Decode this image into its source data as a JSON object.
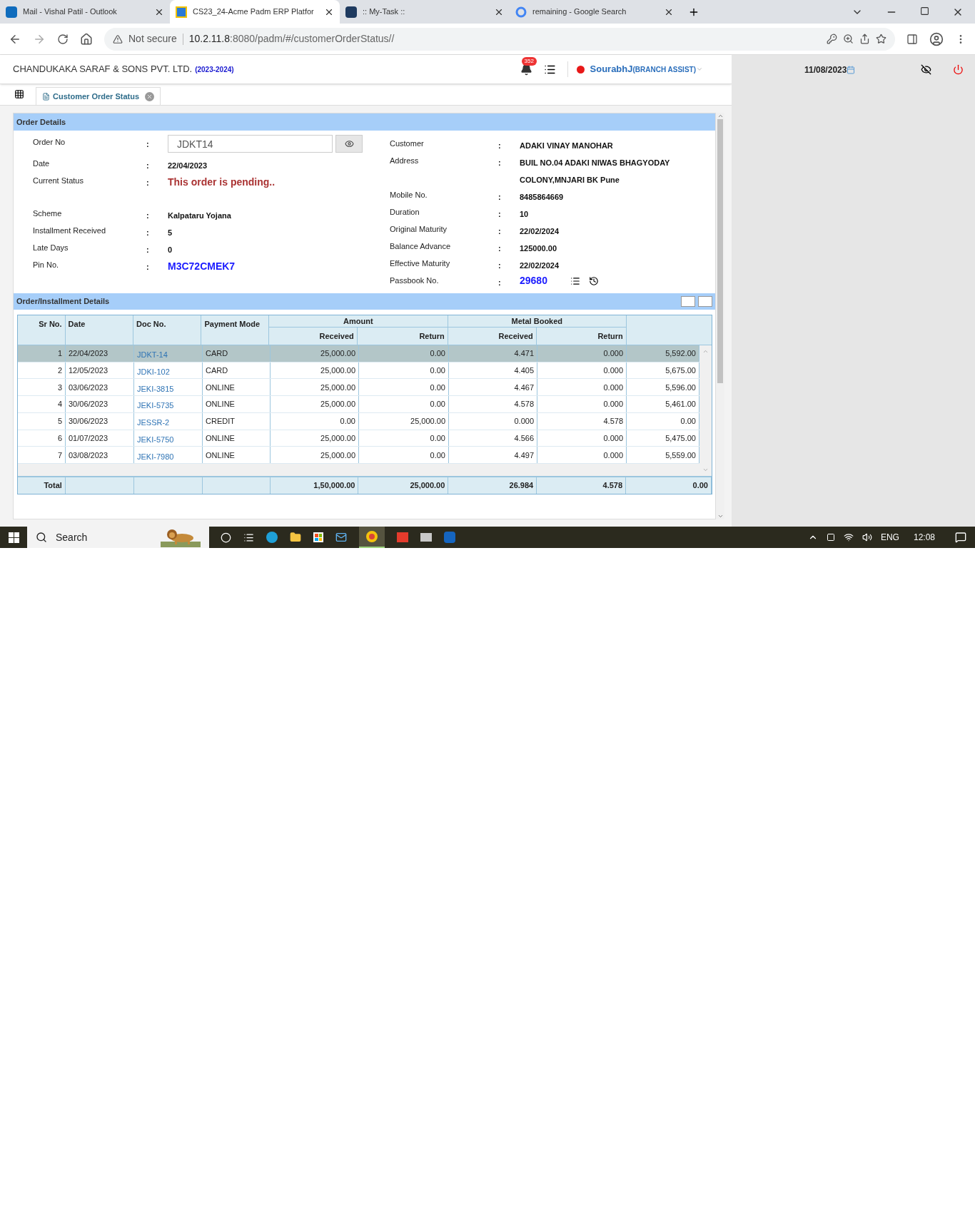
{
  "browser": {
    "tabs": [
      {
        "title": "Mail - Vishal Patil - Outlook",
        "selected": false,
        "kind": "mail"
      },
      {
        "title": "CS23_24-Acme Padm ERP Platfor",
        "selected": true,
        "kind": "erp"
      },
      {
        "title": ":: My-Task ::",
        "selected": false,
        "kind": "task"
      },
      {
        "title": "remaining - Google Search",
        "selected": false,
        "kind": "google"
      }
    ],
    "security": "Not secure",
    "host": "10.2.11.8",
    "path": ":8080/padm/#/customerOrderStatus//"
  },
  "separator": ":",
  "header": {
    "company": "CHANDUKAKA SARAF & SONS PVT. LTD.",
    "year": "(2023-2024)",
    "notifications": "352",
    "user": "SourabhJ",
    "role": "(BRANCH ASSIST)",
    "date": "11/08/2023"
  },
  "page_tabs": [
    {
      "label": "Customer Order Status",
      "selected": true
    }
  ],
  "order_details": {
    "title": "Order Details",
    "left": [
      {
        "label": "Order No",
        "value": "JDKT14",
        "kind": "input"
      },
      {
        "label": "Date",
        "value": "22/04/2023",
        "kind": "text"
      },
      {
        "label": "Current Status",
        "value": "This order is pending..",
        "kind": "status"
      },
      {
        "label": "Scheme",
        "value": "Kalpataru Yojana",
        "kind": "text"
      },
      {
        "label": "Installment Received",
        "value": "5",
        "kind": "text"
      },
      {
        "label": "Late Days",
        "value": "0",
        "kind": "text"
      },
      {
        "label": "Pin No.",
        "value": "M3C72CMEK7",
        "kind": "code"
      }
    ],
    "right": [
      {
        "label": "Customer",
        "value": "ADAKI VINAY MANOHAR",
        "kind": "text"
      },
      {
        "label": "Address",
        "value": "BUIL NO.04 ADAKI NIWAS BHAGYODAY COLONY,MNJARI BK Pune",
        "kind": "text"
      },
      {
        "label": "Mobile No.",
        "value": "8485864669",
        "kind": "text"
      },
      {
        "label": "Duration",
        "value": "10",
        "kind": "text"
      },
      {
        "label": "Original Maturity",
        "value": "22/02/2024",
        "kind": "text"
      },
      {
        "label": "Balance Advance",
        "value": "125000.00",
        "kind": "text"
      },
      {
        "label": "Effective Maturity",
        "value": "22/02/2024",
        "kind": "text"
      },
      {
        "label": "Passbook No.",
        "value": "29680",
        "kind": "passbook"
      }
    ]
  },
  "installments": {
    "title": "Order/Installment Details",
    "columns": [
      "Sr No.",
      "Date",
      "Doc No.",
      "Payment Mode"
    ],
    "groups": [
      {
        "label": "Amount",
        "columns": [
          "Received",
          "Return"
        ]
      },
      {
        "label": "Metal Booked",
        "columns": [
          "Received",
          "Return"
        ]
      }
    ],
    "rows": [
      {
        "selected": true,
        "cells": [
          "1",
          "22/04/2023",
          "JDKT-14",
          "CARD",
          "25,000.00",
          "0.00",
          "4.471",
          "0.000",
          "5,592.00"
        ]
      },
      {
        "selected": false,
        "cells": [
          "2",
          "12/05/2023",
          "JDKI-102",
          "CARD",
          "25,000.00",
          "0.00",
          "4.405",
          "0.000",
          "5,675.00"
        ]
      },
      {
        "selected": false,
        "cells": [
          "3",
          "03/06/2023",
          "JEKI-3815",
          "ONLINE",
          "25,000.00",
          "0.00",
          "4.467",
          "0.000",
          "5,596.00"
        ]
      },
      {
        "selected": false,
        "cells": [
          "4",
          "30/06/2023",
          "JEKI-5735",
          "ONLINE",
          "25,000.00",
          "0.00",
          "4.578",
          "0.000",
          "5,461.00"
        ]
      },
      {
        "selected": false,
        "cells": [
          "5",
          "30/06/2023",
          "JESSR-2",
          "CREDIT",
          "0.00",
          "25,000.00",
          "0.000",
          "4.578",
          "0.00"
        ]
      },
      {
        "selected": false,
        "cells": [
          "6",
          "01/07/2023",
          "JEKI-5750",
          "ONLINE",
          "25,000.00",
          "0.00",
          "4.566",
          "0.000",
          "5,475.00"
        ]
      },
      {
        "selected": false,
        "cells": [
          "7",
          "03/08/2023",
          "JEKI-7980",
          "ONLINE",
          "25,000.00",
          "0.00",
          "4.497",
          "0.000",
          "5,559.00"
        ]
      }
    ],
    "totals": {
      "label": "Total",
      "values": [
        "1,50,000.00",
        "25,000.00",
        "26.984",
        "4.578",
        "0.00"
      ]
    }
  },
  "taskbar": {
    "search": "Search",
    "language": "ENG",
    "time": "12:08"
  }
}
